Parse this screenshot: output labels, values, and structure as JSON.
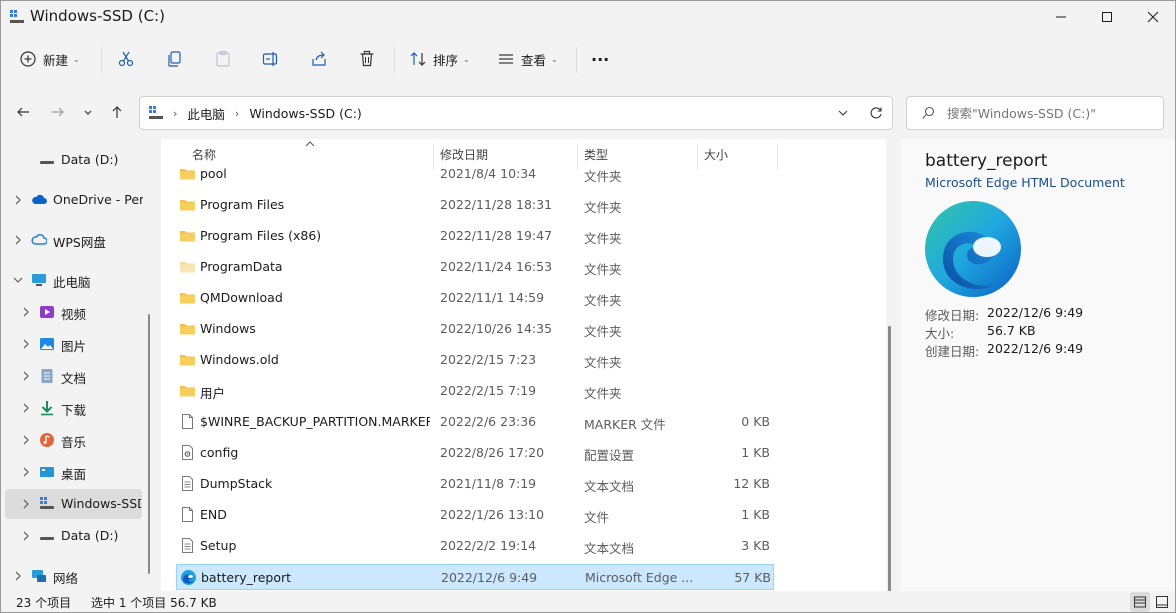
{
  "window": {
    "title": "Windows-SSD (C:)",
    "minimize_glyph": "—",
    "maximize_glyph": "☐",
    "close_glyph": "✕"
  },
  "toolbar": {
    "new_label": "新建",
    "sort_label": "排序",
    "view_label": "查看",
    "more_glyph": "···"
  },
  "breadcrumbs": [
    "此电脑",
    "Windows-SSD (C:)"
  ],
  "search": {
    "placeholder": "搜索\"Windows-SSD (C:)\""
  },
  "nav": {
    "items": [
      {
        "label": "Data (D:)",
        "icon": "drive-icon"
      },
      {
        "label": "OneDrive - Pers",
        "icon": "onedrive-icon"
      },
      {
        "label": "WPS网盘",
        "icon": "wps-cloud-icon"
      },
      {
        "label": "此电脑",
        "icon": "computer-icon"
      },
      {
        "label": "视频",
        "icon": "video-icon"
      },
      {
        "label": "图片",
        "icon": "pictures-icon"
      },
      {
        "label": "文档",
        "icon": "documents-icon"
      },
      {
        "label": "下载",
        "icon": "download-icon"
      },
      {
        "label": "音乐",
        "icon": "music-icon"
      },
      {
        "label": "桌面",
        "icon": "desktop-icon"
      },
      {
        "label": "Windows-SSD",
        "icon": "windows-drive-icon"
      },
      {
        "label": "Data (D:)",
        "icon": "drive-icon"
      },
      {
        "label": "网络",
        "icon": "network-icon"
      }
    ]
  },
  "columns": {
    "name": "名称",
    "date": "修改日期",
    "type": "类型",
    "size": "大小"
  },
  "files": [
    {
      "name": "pool",
      "date": "2021/8/4 10:34",
      "type": "文件夹",
      "size": "",
      "icon": "folder-icon"
    },
    {
      "name": "Program Files",
      "date": "2022/11/28 18:31",
      "type": "文件夹",
      "size": "",
      "icon": "folder-icon"
    },
    {
      "name": "Program Files (x86)",
      "date": "2022/11/28 19:47",
      "type": "文件夹",
      "size": "",
      "icon": "folder-icon"
    },
    {
      "name": "ProgramData",
      "date": "2022/11/24 16:53",
      "type": "文件夹",
      "size": "",
      "icon": "hidden-folder-icon"
    },
    {
      "name": "QMDownload",
      "date": "2022/11/1 14:59",
      "type": "文件夹",
      "size": "",
      "icon": "folder-icon"
    },
    {
      "name": "Windows",
      "date": "2022/10/26 14:35",
      "type": "文件夹",
      "size": "",
      "icon": "folder-icon"
    },
    {
      "name": "Windows.old",
      "date": "2022/2/15 7:23",
      "type": "文件夹",
      "size": "",
      "icon": "folder-icon"
    },
    {
      "name": "用户",
      "date": "2022/2/15 7:19",
      "type": "文件夹",
      "size": "",
      "icon": "folder-icon"
    },
    {
      "name": "$WINRE_BACKUP_PARTITION.MARKER",
      "date": "2022/2/6 23:36",
      "type": "MARKER 文件",
      "size": "0 KB",
      "icon": "file-icon"
    },
    {
      "name": "config",
      "date": "2022/8/26 17:20",
      "type": "配置设置",
      "size": "1 KB",
      "icon": "config-file-icon"
    },
    {
      "name": "DumpStack",
      "date": "2021/11/8 7:19",
      "type": "文本文档",
      "size": "12 KB",
      "icon": "text-file-icon"
    },
    {
      "name": "END",
      "date": "2022/1/26 13:10",
      "type": "文件",
      "size": "1 KB",
      "icon": "file-icon"
    },
    {
      "name": "Setup",
      "date": "2022/2/2 19:14",
      "type": "文本文档",
      "size": "3 KB",
      "icon": "text-file-icon"
    },
    {
      "name": "battery_report",
      "date": "2022/12/6 9:49",
      "type": "Microsoft Edge ...",
      "size": "57 KB",
      "icon": "edge-icon"
    }
  ],
  "details": {
    "title": "battery_report",
    "type": "Microsoft Edge HTML Document",
    "modified_key": "修改日期:",
    "modified_val": "2022/12/6 9:49",
    "size_key": "大小:",
    "size_val": "56.7 KB",
    "created_key": "创建日期:",
    "created_val": "2022/12/6 9:49"
  },
  "status": {
    "count": "23 个项目",
    "selection": "选中 1 个项目  56.7 KB"
  },
  "colors": {
    "folder": "#f2c14e",
    "accent": "#0067c0",
    "selected_row": "#cce8ff"
  }
}
